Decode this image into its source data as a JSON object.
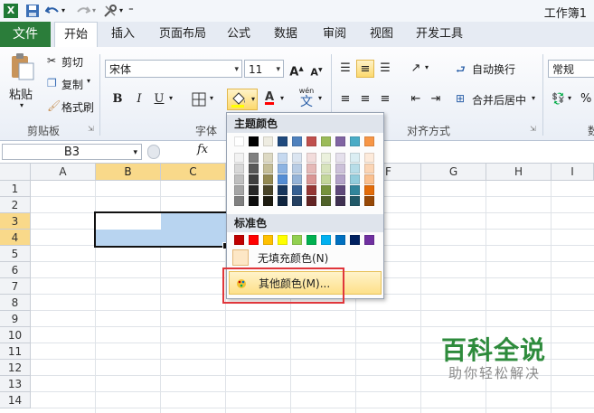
{
  "window": {
    "title": "工作簿1"
  },
  "ribbon": {
    "tabs": [
      {
        "label": "文件"
      },
      {
        "label": "开始"
      },
      {
        "label": "插入"
      },
      {
        "label": "页面布局"
      },
      {
        "label": "公式"
      },
      {
        "label": "数据"
      },
      {
        "label": "审阅"
      },
      {
        "label": "视图"
      },
      {
        "label": "开发工具"
      }
    ],
    "clipboard": {
      "paste": "粘贴",
      "cut": "剪切",
      "copy": "复制",
      "format_painter": "格式刷",
      "group_label": "剪贴板"
    },
    "font": {
      "name": "宋体",
      "size": "11",
      "group_label": "字体",
      "bold": "B",
      "italic": "I",
      "underline": "U",
      "wen": "wén",
      "wen_char": "文",
      "fx_a": "A"
    },
    "alignment": {
      "wrap_text": "自动换行",
      "merge_center": "合并后居中",
      "group_label": "对齐方式"
    },
    "number": {
      "format": "常规",
      "percent": "%",
      "group_label_partial": "数"
    }
  },
  "formula_bar": {
    "name_box": "B3",
    "fx": "fx"
  },
  "grid": {
    "columns": [
      "A",
      "B",
      "C",
      "D",
      "E",
      "F",
      "G",
      "H",
      "I"
    ],
    "rows": [
      "1",
      "2",
      "3",
      "4",
      "5",
      "6",
      "7",
      "8",
      "9",
      "10",
      "11",
      "12",
      "13",
      "14"
    ],
    "selected_columns": [
      "B",
      "C"
    ],
    "selected_rows": [
      "3",
      "4"
    ]
  },
  "fill_color_menu": {
    "theme_colors_label": "主题颜色",
    "standard_colors_label": "标准色",
    "no_fill": "无填充颜色(N)",
    "more_colors": "其他颜色(M)...",
    "theme_top": [
      "#ffffff",
      "#000000",
      "#eeece1",
      "#1f497d",
      "#4f81bd",
      "#c0504d",
      "#9bbb59",
      "#8064a2",
      "#4bacc6",
      "#f79646"
    ],
    "theme_shades": [
      [
        "#f2f2f2",
        "#7f7f7f",
        "#ddd9c3",
        "#c6d9f0",
        "#dbe5f1",
        "#f2dcdb",
        "#ebf1dd",
        "#e5e0ec",
        "#dbeef3",
        "#fdeada"
      ],
      [
        "#d8d8d8",
        "#595959",
        "#c4bd97",
        "#8db3e2",
        "#b8cce4",
        "#e5b9b7",
        "#d7e3bc",
        "#ccc1d9",
        "#b7dde8",
        "#fbd5b5"
      ],
      [
        "#bfbfbf",
        "#3f3f3f",
        "#938953",
        "#548dd4",
        "#95b3d7",
        "#d99694",
        "#c3d69b",
        "#b2a2c7",
        "#92cddc",
        "#fac08f"
      ],
      [
        "#a5a5a5",
        "#262626",
        "#494429",
        "#17365d",
        "#366092",
        "#953734",
        "#76923c",
        "#5f497a",
        "#31859b",
        "#e36c09"
      ],
      [
        "#7f7f7f",
        "#0c0c0c",
        "#1d1b10",
        "#0f243e",
        "#244061",
        "#632423",
        "#4f6128",
        "#3f3151",
        "#205867",
        "#974806"
      ]
    ],
    "standard": [
      "#c00000",
      "#ff0000",
      "#ffc000",
      "#ffff00",
      "#92d050",
      "#00b050",
      "#00b0f0",
      "#0070c0",
      "#002060",
      "#7030a0"
    ]
  },
  "selection_fill_color": "#b8d4f0",
  "watermark": {
    "title": "百科全说",
    "subtitle": "助你轻松解决"
  }
}
